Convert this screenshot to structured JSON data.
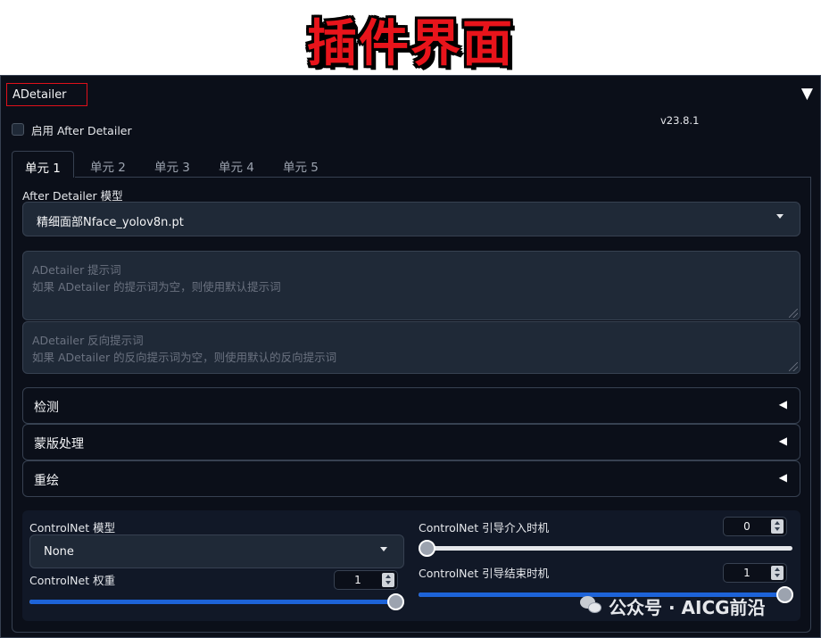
{
  "banner": {
    "title": "插件界面"
  },
  "accordion": {
    "title": "ADetailer",
    "arrow": "▼"
  },
  "enable": {
    "label": "启用 After Detailer",
    "checked": false
  },
  "version": "v23.8.1",
  "tabs": [
    "单元 1",
    "单元 2",
    "单元 3",
    "单元 4",
    "单元 5"
  ],
  "active_tab": 0,
  "model": {
    "label": "After Detailer 模型",
    "value": "精细面部Nface_yolov8n.pt"
  },
  "prompt": {
    "placeholder_line1": "ADetailer 提示词",
    "placeholder_line2": "如果 ADetailer 的提示词为空，则使用默认提示词"
  },
  "neg_prompt": {
    "placeholder_line1": "ADetailer 反向提示词",
    "placeholder_line2": "如果 ADetailer 的反向提示词为空，则使用默认的反向提示词"
  },
  "sections": [
    {
      "label": "检测",
      "arrow": "◀"
    },
    {
      "label": "蒙版处理",
      "arrow": "◀"
    },
    {
      "label": "重绘",
      "arrow": "◀"
    }
  ],
  "controlnet": {
    "model_label": "ControlNet 模型",
    "model_value": "None",
    "weight_label": "ControlNet 权重",
    "weight_value": "1",
    "weight_fraction": 1.0,
    "start_label": "ControlNet 引导介入时机",
    "start_value": "0",
    "start_fraction": 0.0,
    "end_label": "ControlNet 引导结束时机",
    "end_value": "1",
    "end_fraction": 1.0
  },
  "colors": {
    "background": "#0b0f19",
    "accent": "#1d63d8",
    "highlight_border": "#e0101a",
    "banner_red": "#e8141b"
  },
  "watermark": {
    "icon": "wechat-icon",
    "text": "公众号 · AICG前沿"
  }
}
